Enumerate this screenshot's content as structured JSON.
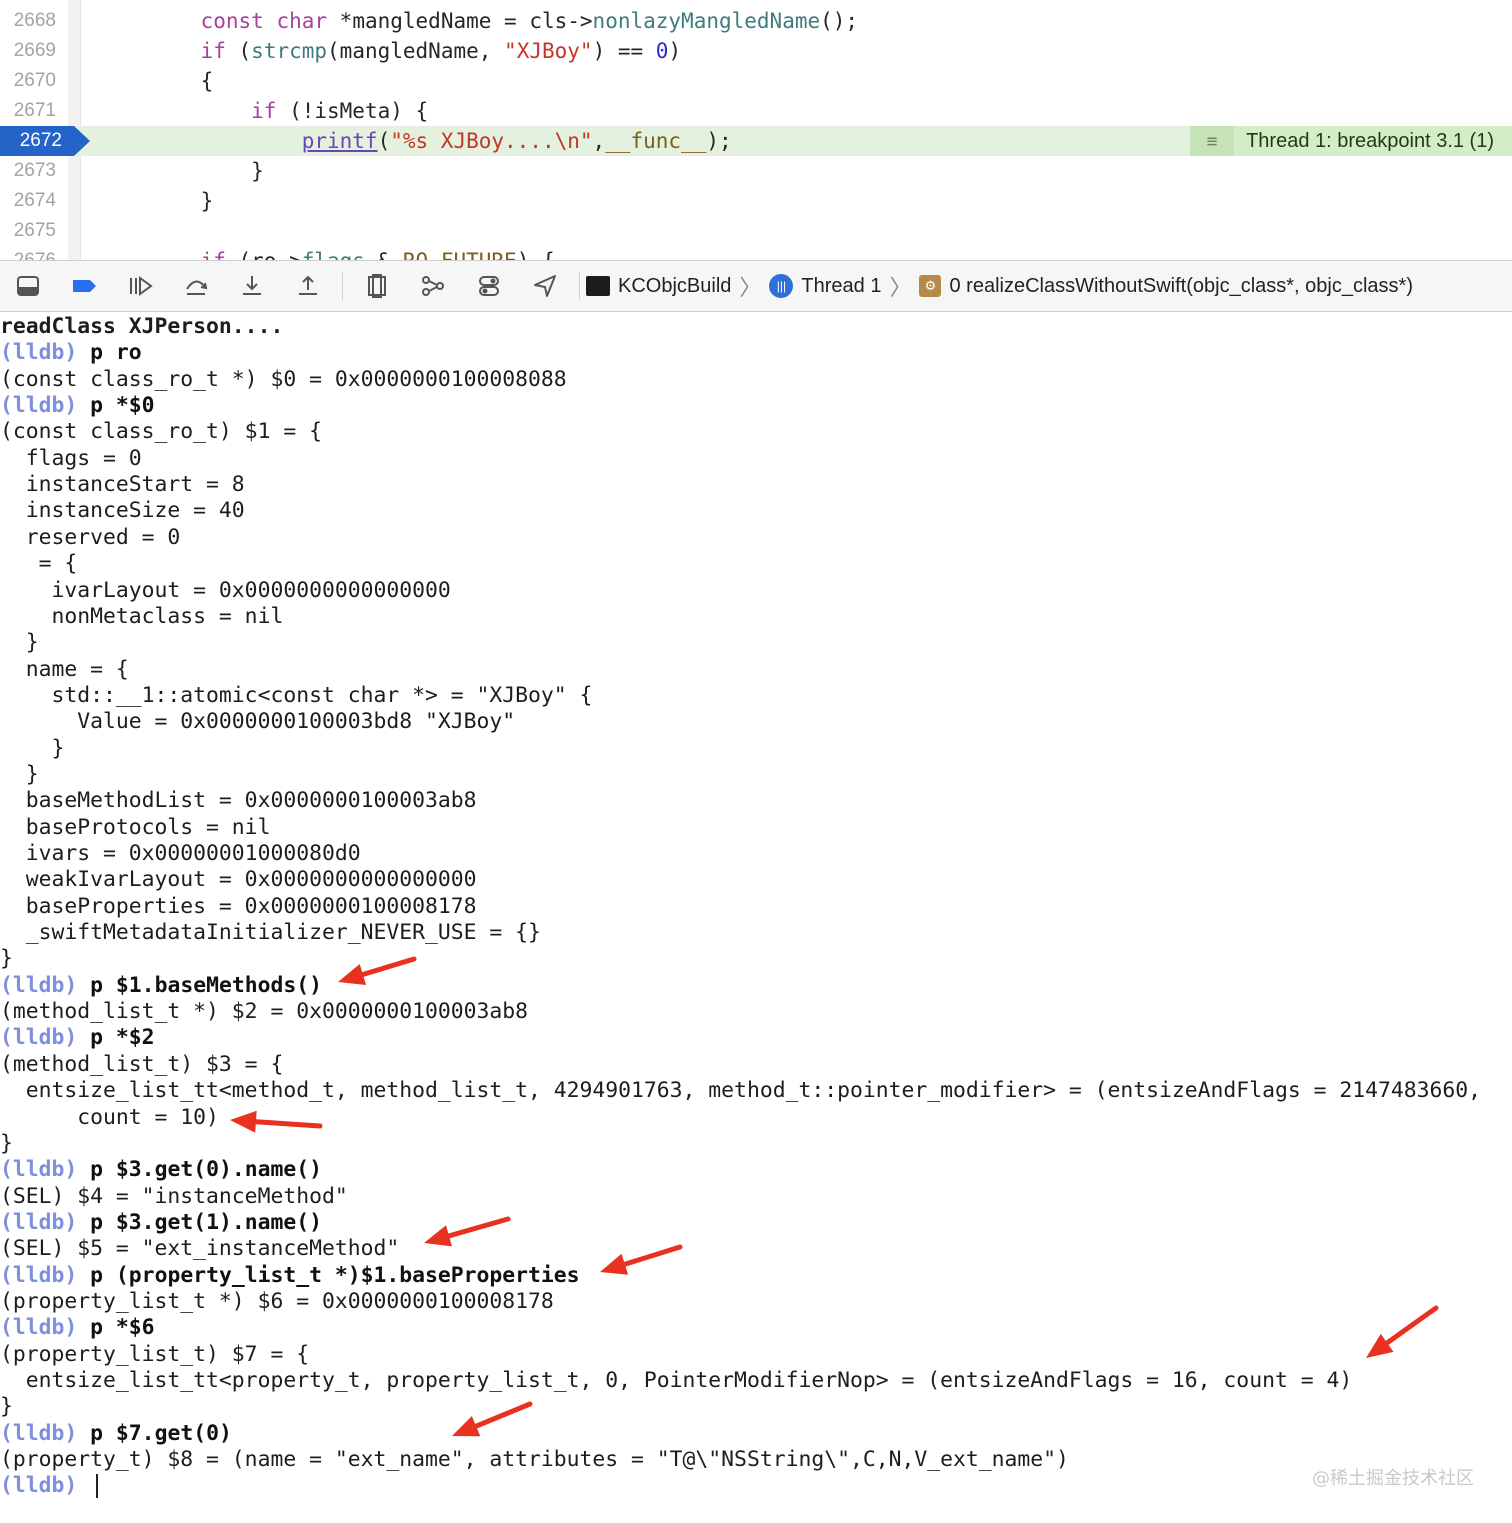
{
  "editor": {
    "lines": [
      {
        "num": "2668",
        "tokens": [
          [
            "plain",
            "    "
          ],
          [
            "kw",
            "const"
          ],
          [
            "plain",
            " "
          ],
          [
            "kw",
            "char"
          ],
          [
            "plain",
            " *mangledName = cls->"
          ],
          [
            "fn",
            "nonlazyMangledName"
          ],
          [
            "plain",
            "();"
          ]
        ]
      },
      {
        "num": "2669",
        "tokens": [
          [
            "plain",
            "    "
          ],
          [
            "kw",
            "if"
          ],
          [
            "plain",
            " ("
          ],
          [
            "fn",
            "strcmp"
          ],
          [
            "plain",
            "(mangledName, "
          ],
          [
            "str",
            "\"XJBoy\""
          ],
          [
            "plain",
            ") == "
          ],
          [
            "num",
            "0"
          ],
          [
            "plain",
            ")"
          ]
        ]
      },
      {
        "num": "2670",
        "tokens": [
          [
            "plain",
            "    {"
          ]
        ]
      },
      {
        "num": "2671",
        "tokens": [
          [
            "plain",
            "        "
          ],
          [
            "kw",
            "if"
          ],
          [
            "plain",
            " (!isMeta) {"
          ]
        ]
      },
      {
        "num": "2672",
        "current": true,
        "tokens": [
          [
            "plain",
            "            "
          ],
          [
            "fnu",
            "printf"
          ],
          [
            "plain",
            "("
          ],
          [
            "str",
            "\"%s XJBoy....\\n\""
          ],
          [
            "plain",
            ","
          ],
          [
            "mac",
            "__func__"
          ],
          [
            "plain",
            ");"
          ]
        ]
      },
      {
        "num": "2673",
        "tokens": [
          [
            "plain",
            "        }"
          ]
        ]
      },
      {
        "num": "2674",
        "tokens": [
          [
            "plain",
            "    }"
          ]
        ]
      },
      {
        "num": "2675",
        "tokens": [
          [
            "plain",
            ""
          ]
        ]
      },
      {
        "num": "2676",
        "tokens": [
          [
            "plain",
            "    "
          ],
          [
            "kw",
            "if"
          ],
          [
            "plain",
            " (ro->"
          ],
          [
            "fn",
            "flags"
          ],
          [
            "plain",
            " & "
          ],
          [
            "mac",
            "RO_FUTURE"
          ],
          [
            "plain",
            ") {"
          ]
        ]
      }
    ],
    "breakpoint_label": "Thread 1: breakpoint 3.1 (1)",
    "breakpoint_icon": "list-lines-icon"
  },
  "toolbar": {
    "icons": [
      "hide-debug-area-icon",
      "breakpoints-toggle-icon",
      "continue-icon",
      "step-over-icon",
      "step-into-icon",
      "step-out-icon",
      "view-hierarchy-icon",
      "memory-graph-icon",
      "environment-overrides-icon",
      "simulate-location-icon"
    ],
    "breadcrumb": {
      "target": "KCObjcBuild",
      "thread": "Thread 1",
      "frame": "0 realizeClassWithoutSwift(objc_class*, objc_class*)"
    }
  },
  "console": {
    "prompt": "(lldb)",
    "lines": [
      {
        "type": "out",
        "bold": true,
        "text": "readClass XJPerson...."
      },
      {
        "type": "cmd",
        "text": "p ro"
      },
      {
        "type": "out",
        "text": "(const class_ro_t *) $0 = 0x0000000100008088"
      },
      {
        "type": "cmd",
        "text": "p *$0"
      },
      {
        "type": "out",
        "text": "(const class_ro_t) $1 = {"
      },
      {
        "type": "out",
        "text": "  flags = 0"
      },
      {
        "type": "out",
        "text": "  instanceStart = 8"
      },
      {
        "type": "out",
        "text": "  instanceSize = 40"
      },
      {
        "type": "out",
        "text": "  reserved = 0"
      },
      {
        "type": "out",
        "text": "   = {"
      },
      {
        "type": "out",
        "text": "    ivarLayout = 0x0000000000000000"
      },
      {
        "type": "out",
        "text": "    nonMetaclass = nil"
      },
      {
        "type": "out",
        "text": "  }"
      },
      {
        "type": "out",
        "text": "  name = {"
      },
      {
        "type": "out",
        "text": "    std::__1::atomic<const char *> = \"XJBoy\" {"
      },
      {
        "type": "out",
        "text": "      Value = 0x0000000100003bd8 \"XJBoy\""
      },
      {
        "type": "out",
        "text": "    }"
      },
      {
        "type": "out",
        "text": "  }"
      },
      {
        "type": "out",
        "text": "  baseMethodList = 0x0000000100003ab8"
      },
      {
        "type": "out",
        "text": "  baseProtocols = nil"
      },
      {
        "type": "out",
        "text": "  ivars = 0x00000001000080d0"
      },
      {
        "type": "out",
        "text": "  weakIvarLayout = 0x0000000000000000"
      },
      {
        "type": "out",
        "text": "  baseProperties = 0x0000000100008178"
      },
      {
        "type": "out",
        "text": "  _swiftMetadataInitializer_NEVER_USE = {}"
      },
      {
        "type": "out",
        "text": "}"
      },
      {
        "type": "cmd",
        "text": "p $1.baseMethods()"
      },
      {
        "type": "out",
        "text": "(method_list_t *) $2 = 0x0000000100003ab8"
      },
      {
        "type": "cmd",
        "text": "p *$2"
      },
      {
        "type": "out",
        "text": "(method_list_t) $3 = {"
      },
      {
        "type": "out",
        "text": "  entsize_list_tt<method_t, method_list_t, 4294901763, method_t::pointer_modifier> = (entsizeAndFlags = 2147483660,"
      },
      {
        "type": "out",
        "text": "      count = 10)"
      },
      {
        "type": "out",
        "text": "}"
      },
      {
        "type": "cmd",
        "text": "p $3.get(0).name()"
      },
      {
        "type": "out",
        "text": "(SEL) $4 = \"instanceMethod\""
      },
      {
        "type": "cmd",
        "text": "p $3.get(1).name()"
      },
      {
        "type": "out",
        "text": "(SEL) $5 = \"ext_instanceMethod\""
      },
      {
        "type": "cmd",
        "text": "p (property_list_t *)$1.baseProperties"
      },
      {
        "type": "out",
        "text": "(property_list_t *) $6 = 0x0000000100008178"
      },
      {
        "type": "cmd",
        "text": "p *$6"
      },
      {
        "type": "out",
        "text": "(property_list_t) $7 = {"
      },
      {
        "type": "out",
        "text": "  entsize_list_tt<property_t, property_list_t, 0, PointerModifierNop> = (entsizeAndFlags = 16, count = 4)"
      },
      {
        "type": "out",
        "text": "}"
      },
      {
        "type": "cmd",
        "text": "p $7.get(0)"
      },
      {
        "type": "out",
        "text": "(property_t) $8 = (name = \"ext_name\", attributes = \"T@\\\"NSString\\\",C,N,V_ext_name\")"
      },
      {
        "type": "prompt",
        "text": ""
      }
    ]
  },
  "annotation_color": "#e8321f",
  "watermark": "@稀土掘金技术社区"
}
